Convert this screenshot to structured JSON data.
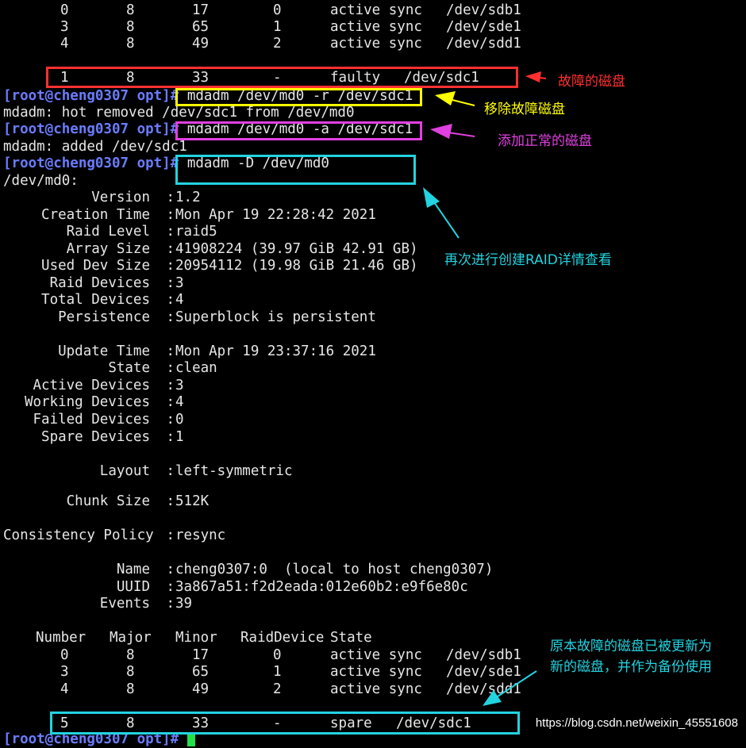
{
  "top_rows": [
    {
      "number": "0",
      "major": "8",
      "minor": "17",
      "raid": "0",
      "state": "active sync",
      "dev": "/dev/sdb1"
    },
    {
      "number": "3",
      "major": "8",
      "minor": "65",
      "raid": "1",
      "state": "active sync",
      "dev": "/dev/sde1"
    },
    {
      "number": "4",
      "major": "8",
      "minor": "49",
      "raid": "2",
      "state": "active sync",
      "dev": "/dev/sdd1"
    }
  ],
  "faulty_row": {
    "number": "1",
    "major": "8",
    "minor": "33",
    "raid": "-",
    "state": "faulty",
    "dev": "/dev/sdc1"
  },
  "prompt": "[root@cheng0307 opt]#",
  "cmd1": "mdadm /dev/md0 -r /dev/sdc1",
  "out1": "mdadm: hot removed /dev/sdc1 from /dev/md0",
  "cmd2": "mdadm /dev/md0 -a /dev/sdc1",
  "out2": "mdadm: added /dev/sdc1",
  "cmd3": "mdadm -D /dev/md0",
  "dev_header": "/dev/md0:",
  "details": [
    {
      "key": "Version",
      "value": "1.2"
    },
    {
      "key": "Creation Time",
      "value": "Mon Apr 19 22:28:42 2021"
    },
    {
      "key": "Raid Level",
      "value": "raid5"
    },
    {
      "key": "Array Size",
      "value": "41908224 (39.97 GiB 42.91 GB)"
    },
    {
      "key": "Used Dev Size",
      "value": "20954112 (19.98 GiB 21.46 GB)"
    },
    {
      "key": "Raid Devices",
      "value": "3"
    },
    {
      "key": "Total Devices",
      "value": "4"
    },
    {
      "key": "Persistence",
      "value": "Superblock is persistent"
    },
    {
      "key": "Update Time",
      "value": "Mon Apr 19 23:37:16 2021"
    },
    {
      "key": "State",
      "value": "clean"
    },
    {
      "key": "Active Devices",
      "value": "3"
    },
    {
      "key": "Working Devices",
      "value": "4"
    },
    {
      "key": "Failed Devices",
      "value": "0"
    },
    {
      "key": "Spare Devices",
      "value": "1"
    },
    {
      "key": "Layout",
      "value": "left-symmetric"
    },
    {
      "key": "Chunk Size",
      "value": "512K"
    },
    {
      "key": "Consistency Policy",
      "value": "resync"
    },
    {
      "key": "Name",
      "value": "cheng0307:0  (local to host cheng0307)"
    },
    {
      "key": "UUID",
      "value": "3a867a51:f2d2eada:012e60b2:e9f6e80c"
    },
    {
      "key": "Events",
      "value": "39"
    }
  ],
  "table_header": {
    "number": "Number",
    "major": "Major",
    "minor": "Minor",
    "raid": "RaidDevice",
    "state": "State"
  },
  "bottom_rows": [
    {
      "number": "0",
      "major": "8",
      "minor": "17",
      "raid": "0",
      "state": "active sync",
      "dev": "/dev/sdb1"
    },
    {
      "number": "3",
      "major": "8",
      "minor": "65",
      "raid": "1",
      "state": "active sync",
      "dev": "/dev/sde1"
    },
    {
      "number": "4",
      "major": "8",
      "minor": "49",
      "raid": "2",
      "state": "active sync",
      "dev": "/dev/sdd1"
    }
  ],
  "spare_row": {
    "number": "5",
    "major": "8",
    "minor": "33",
    "raid": "-",
    "state": "spare",
    "dev": "/dev/sdc1"
  },
  "last_prompt": "[root@cheng0307 opt]#",
  "annotations": {
    "faulty": "故障的磁盘",
    "remove": "移除故障磁盘",
    "add": "添加正常的磁盘",
    "detail": "再次进行创建RAID详情查看",
    "spare_line1": "原本故障的磁盘已被更新为",
    "spare_line2": "新的磁盘，并作为备份使用"
  },
  "watermark": "https://blog.csdn.net/weixin_45551608",
  "colors": {
    "red": "#ff3030",
    "yellow": "#ffff00",
    "magenta": "#e040e0",
    "cyan": "#22d3e0",
    "prompt": "#6a7cff",
    "text": "#e6e6e6",
    "cursor": "#22e04a"
  }
}
